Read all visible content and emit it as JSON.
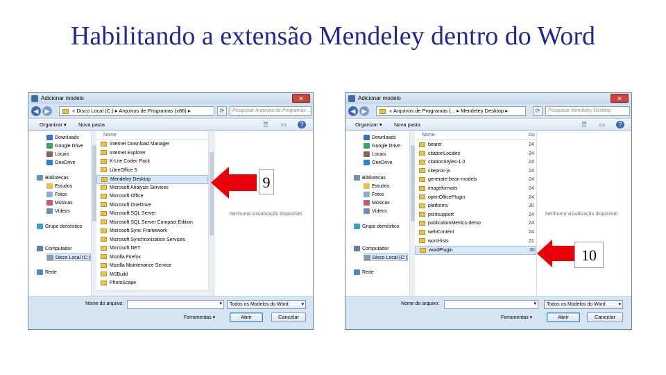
{
  "slide": {
    "title": "Habilitando a extensão Mendeley dentro do Word"
  },
  "dialog_left": {
    "title": "Adicionar modelo",
    "address_prefix": "«",
    "address_parts": [
      "Disco Local (C:)",
      "Arquivos de Programas (x86)"
    ],
    "search_placeholder": "Pesquisar Arquivos de Programas ...",
    "toolbar": {
      "organize": "Organizar ▾",
      "new_folder": "Nova pasta"
    },
    "nav": [
      "Downloads",
      "Google Drive",
      "Locais",
      "OneDrive",
      "Bibliotecas",
      "Estudos",
      "Fotos",
      "Músicas",
      "Vídeos",
      "Grupo doméstico",
      "Computador",
      "Disco Local (C:)",
      "Rede"
    ],
    "column_name": "Nome",
    "files": [
      "Internet Download Manager",
      "Internet Explorer",
      "K-Lite Codec Pack",
      "LibreOffice 5",
      "Mendeley Desktop",
      "Microsoft Analysis Services",
      "Microsoft Office",
      "Microsoft OneDrive",
      "Microsoft SQL Server",
      "Microsoft SQL Server Compact Edition",
      "Microsoft Sync Framework",
      "Microsoft Synchronization Services",
      "Microsoft.NET",
      "Mozilla Firefox",
      "Mozilla Maintenance Service",
      "MSBuild",
      "PhotoScape"
    ],
    "selected_file_index": 4,
    "preview_text": "Nenhuma visualização disponível.",
    "filename_label": "Nome do arquivo:",
    "filetype_value": "Todos os Modelos do Word",
    "tools_label": "Ferramentas ▾",
    "open_button": "Abrir",
    "cancel_button": "Cancelar"
  },
  "dialog_right": {
    "title": "Adicionar modelo",
    "address_prefix": "«",
    "address_parts": [
      "Arquivos de Programas (...",
      "Mendeley Desktop"
    ],
    "search_placeholder": "Pesquisar Mendeley Desktop",
    "toolbar": {
      "organize": "Organizar ▾",
      "new_folder": "Nova pasta"
    },
    "nav": [
      "Downloads",
      "Google Drive",
      "Locais",
      "OneDrive",
      "Bibliotecas",
      "Estudos",
      "Fotos",
      "Músicas",
      "Vídeos",
      "Grupo doméstico",
      "Computador",
      "Disco Local (C:)",
      "Rede"
    ],
    "column_name": "Nome",
    "column_date": "Da",
    "files": [
      {
        "name": "bearer",
        "date": "24"
      },
      {
        "name": "citationLocales",
        "date": "24"
      },
      {
        "name": "citationStyles-1.0",
        "date": "24"
      },
      {
        "name": "citeproc-js",
        "date": "24"
      },
      {
        "name": "generate-bean-models",
        "date": "24"
      },
      {
        "name": "imageformats",
        "date": "24"
      },
      {
        "name": "openOfficePlugin",
        "date": "24"
      },
      {
        "name": "platforms",
        "date": "30"
      },
      {
        "name": "printsupport",
        "date": "24"
      },
      {
        "name": "publicationMetrics-demo",
        "date": "24"
      },
      {
        "name": "webContent",
        "date": "24"
      },
      {
        "name": "word-lists",
        "date": "21"
      },
      {
        "name": "wordPlugin",
        "date": "30"
      }
    ],
    "selected_file_index": 12,
    "preview_text": "Nenhuma visualização disponível.",
    "filename_label": "Nome do arquivo:",
    "filetype_value": "Todos os Modelos do Word",
    "tools_label": "Ferramentas ▾",
    "open_button": "Abrir",
    "cancel_button": "Cancelar"
  },
  "annotations": {
    "step_left": "9",
    "step_right": "10",
    "arrow_color": "#e8000a"
  }
}
